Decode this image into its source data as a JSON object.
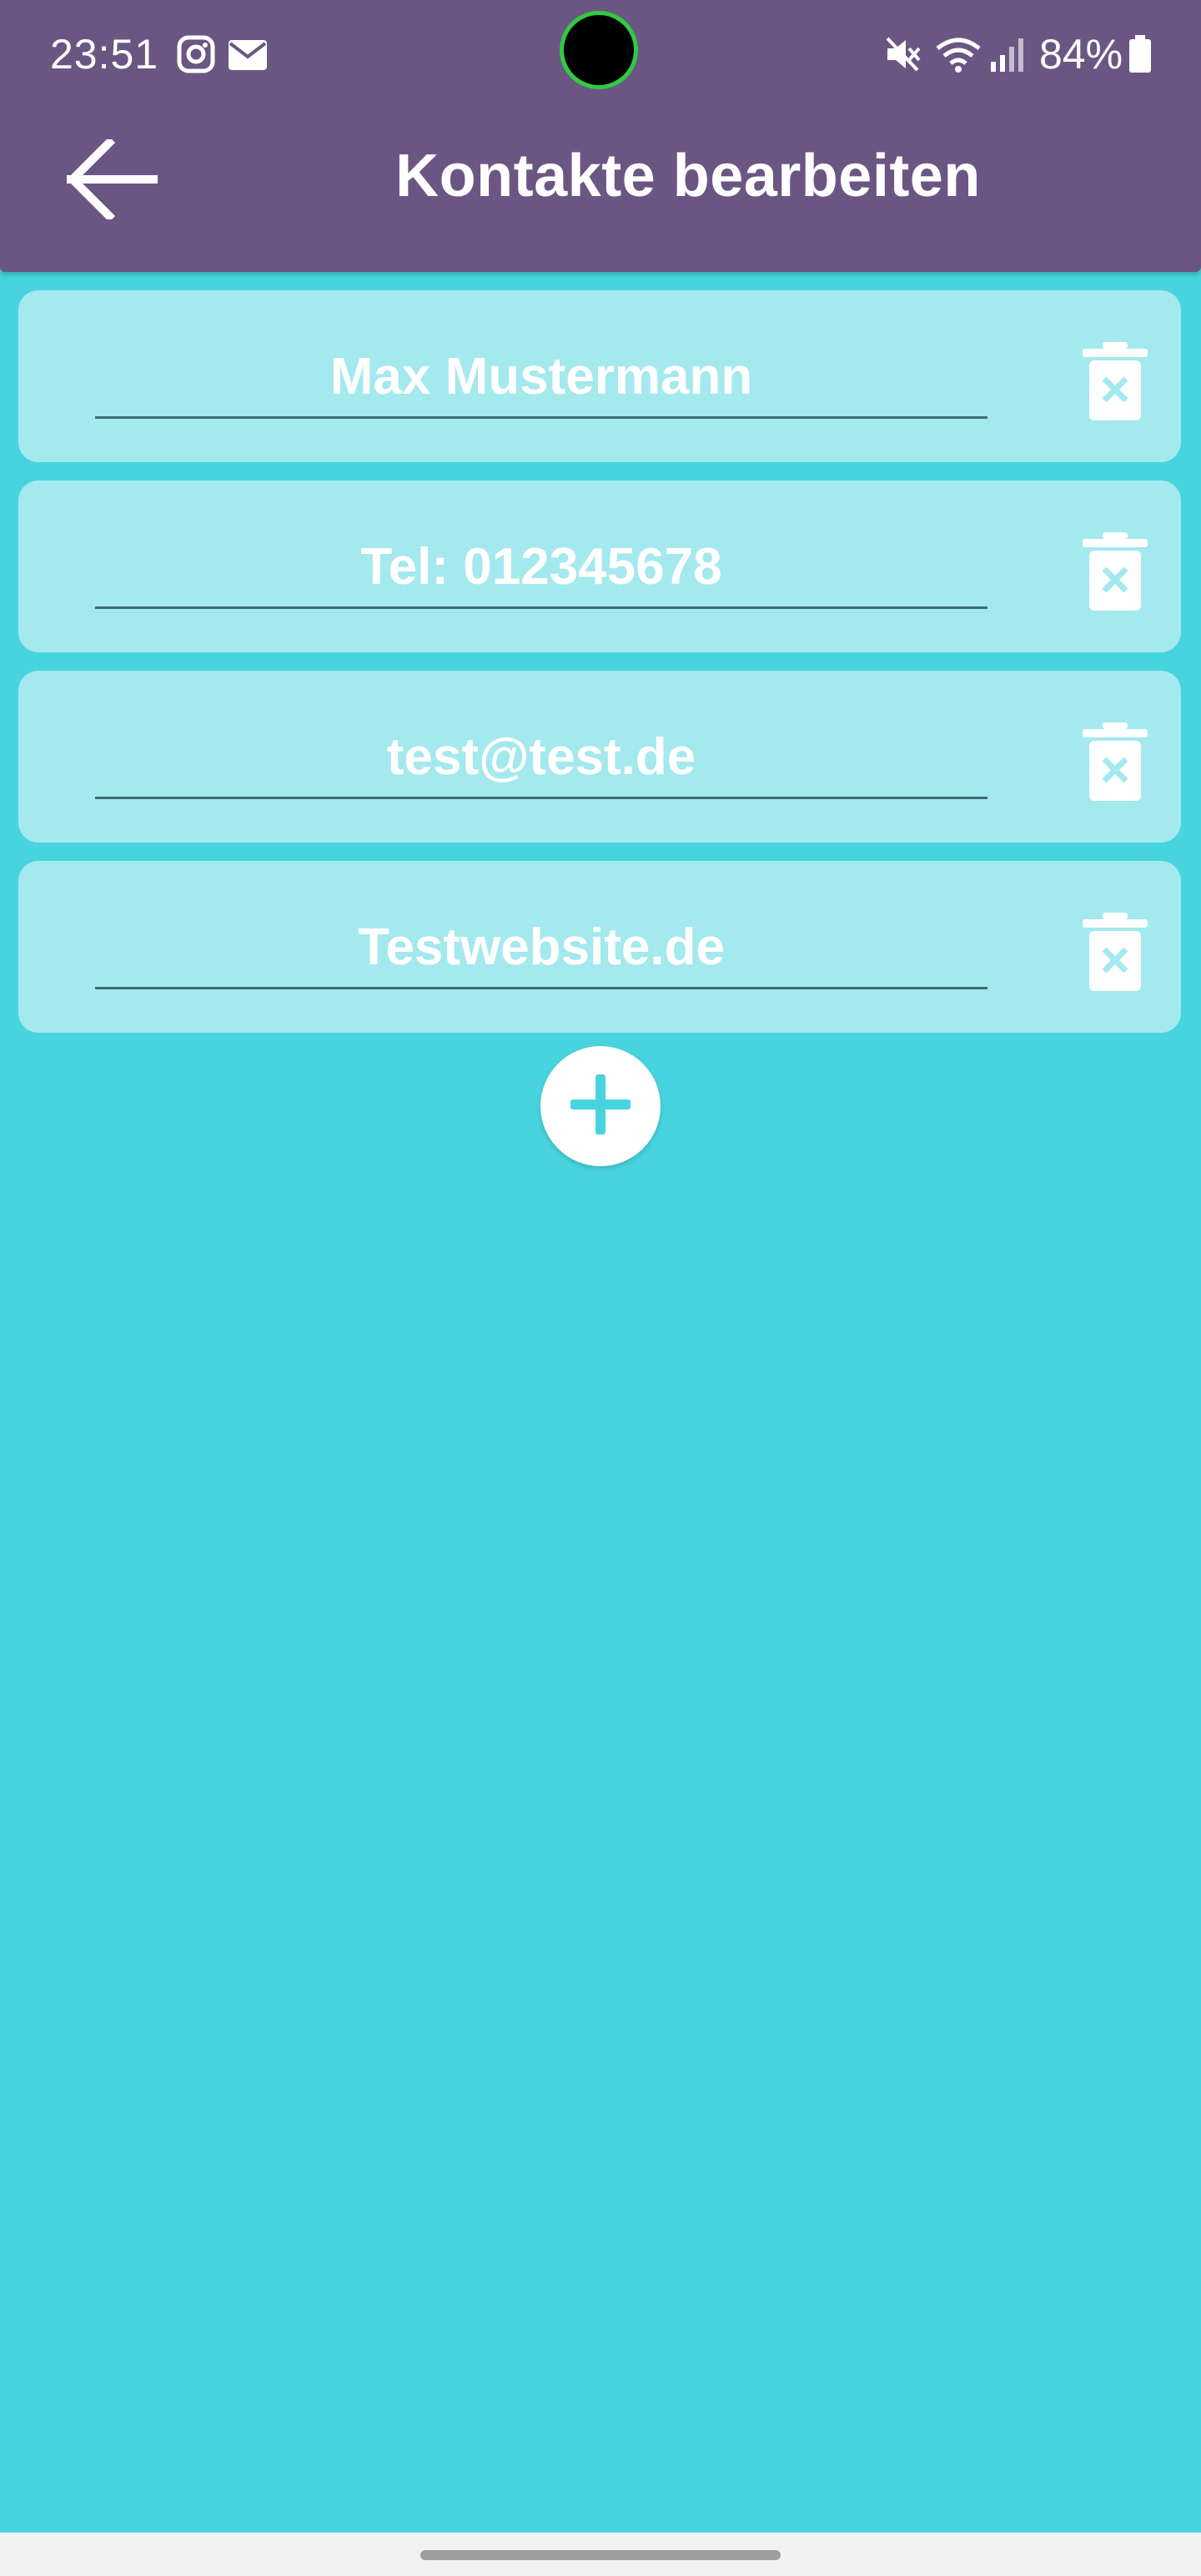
{
  "status_bar": {
    "time": "23:51",
    "battery": "84%",
    "icons": [
      "instagram-icon",
      "mail-icon",
      "mute-icon",
      "wifi-icon",
      "signal-icon",
      "battery-icon"
    ]
  },
  "app_bar": {
    "title": "Kontakte bearbeiten",
    "back_icon": "arrow-left-icon"
  },
  "contact_fields": [
    {
      "value": "Max Mustermann"
    },
    {
      "value": "Tel: 012345678"
    },
    {
      "value": "test@test.de"
    },
    {
      "value": "Testwebsite.de"
    }
  ],
  "add_button_icon": "plus-icon",
  "colors": {
    "app_bar": "#6b5683",
    "background": "#48d4de",
    "card": "#a3e9ee",
    "accent": "#48d4de",
    "text": "#ffffff"
  }
}
